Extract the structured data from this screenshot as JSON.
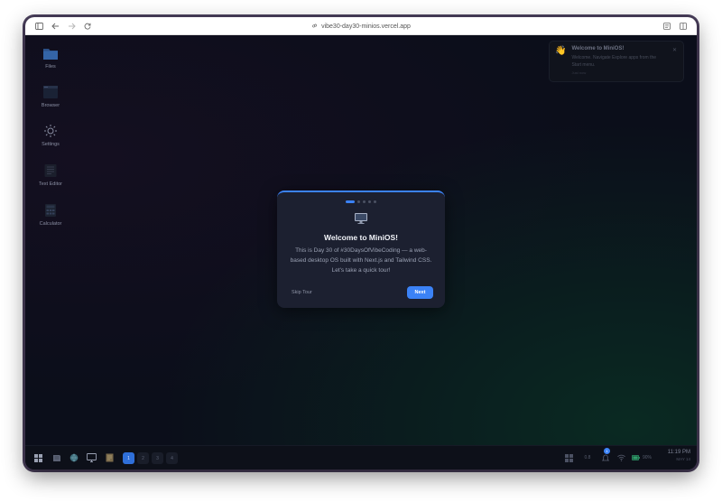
{
  "browser": {
    "url": "vibe30-day30-minios.vercel.app"
  },
  "desktop": {
    "icons": [
      {
        "label": "Files",
        "icon": "folder-icon"
      },
      {
        "label": "Browser",
        "icon": "browser-icon"
      },
      {
        "label": "Settings",
        "icon": "gear-icon"
      },
      {
        "label": "Text Editor",
        "icon": "text-editor-icon"
      },
      {
        "label": "Calculator",
        "icon": "calculator-icon"
      }
    ]
  },
  "notification": {
    "title": "Welcome to MiniOS!",
    "body": "Welcome. Navigate Explore apps from the Start menu.",
    "time": "Just now",
    "emoji": "👋"
  },
  "tour": {
    "step": 1,
    "steps_total": 5,
    "title": "Welcome to MiniOS!",
    "body": "This is Day 30 of #30DaysOfVibeCoding — a web-based desktop OS built with Next.js and Tailwind CSS. Let's take a quick tour!",
    "skip_label": "Skip Tour",
    "next_label": "Next"
  },
  "taskbar": {
    "workspaces": [
      "1",
      "2",
      "3",
      "4"
    ],
    "active_workspace": "1",
    "tray": {
      "volume": "0.8",
      "notifications_badge": "1",
      "battery": "90%"
    },
    "clock": {
      "time": "11:19 PM",
      "date": "MAY 14"
    }
  },
  "colors": {
    "accent": "#3b82f6",
    "modal_bg": "#1c2030",
    "desktop_bg": "#0b0e1a"
  }
}
